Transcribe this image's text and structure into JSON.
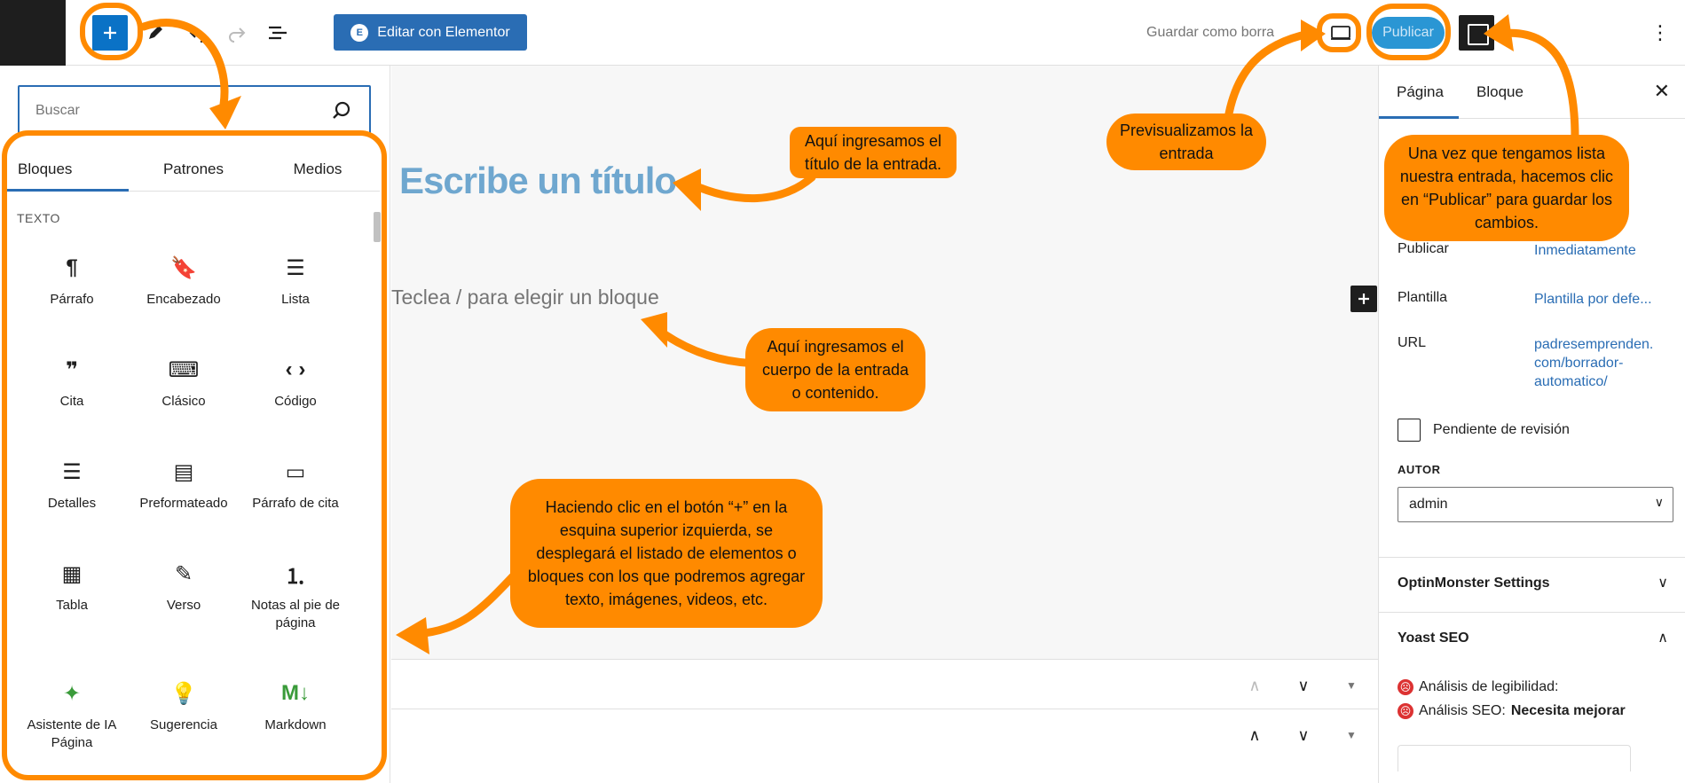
{
  "topbar": {
    "add_block_icon": "plus-icon",
    "elementor_label": "Editar con Elementor",
    "save_draft": "Guardar como borra",
    "publish": "Publicar"
  },
  "inserter": {
    "search_placeholder": "Buscar",
    "tabs": [
      "Bloques",
      "Patrones",
      "Medios"
    ],
    "category": "TEXTO",
    "blocks": [
      {
        "label": "Párrafo",
        "icon": "paragraph-icon",
        "glyph": "¶"
      },
      {
        "label": "Encabezado",
        "icon": "bookmark-icon",
        "glyph": "🔖"
      },
      {
        "label": "Lista",
        "icon": "list-icon",
        "glyph": "☰"
      },
      {
        "label": "Cita",
        "icon": "quote-icon",
        "glyph": "❞"
      },
      {
        "label": "Clásico",
        "icon": "keyboard-icon",
        "glyph": "⌨"
      },
      {
        "label": "Código",
        "icon": "code-icon",
        "glyph": "‹ ›"
      },
      {
        "label": "Detalles",
        "icon": "details-icon",
        "glyph": "☰"
      },
      {
        "label": "Preformateado",
        "icon": "preformatted-icon",
        "glyph": "▤"
      },
      {
        "label": "Párrafo de cita",
        "icon": "pullquote-icon",
        "glyph": "▭"
      },
      {
        "label": "Tabla",
        "icon": "table-icon",
        "glyph": "▦"
      },
      {
        "label": "Verso",
        "icon": "feather-icon",
        "glyph": "✎"
      },
      {
        "label": "Notas al pie de página",
        "icon": "footnotes-icon",
        "glyph": "⒈"
      },
      {
        "label": "Asistente de IA Página",
        "icon": "sparkles-icon",
        "glyph": "✦"
      },
      {
        "label": "Sugerencia",
        "icon": "lightbulb-icon",
        "glyph": "💡"
      },
      {
        "label": "Markdown",
        "icon": "markdown-icon",
        "glyph": "M↓"
      }
    ]
  },
  "editor": {
    "title_placeholder": "Escribe un título",
    "body_placeholder": "Teclea / para elegir un bloque"
  },
  "sidebar": {
    "tabs": [
      "Página",
      "Bloque"
    ],
    "publish_label": "Publicar",
    "publish_value": "Inmediatamente",
    "template_label": "Plantilla",
    "template_value": "Plantilla por defe...",
    "url_label": "URL",
    "url_value_1": "padresemprenden.",
    "url_value_2": "com/borrador-",
    "url_value_3": "automatico/",
    "pending_review": "Pendiente de revisión",
    "author_label": "AUTOR",
    "author_value": "admin",
    "optin_title": "OptinMonster Settings",
    "yoast_title": "Yoast SEO",
    "readability": "Análisis de legibilidad:",
    "seo_analysis": "Análisis SEO:",
    "seo_status": "Necesita mejorar"
  },
  "annotations": {
    "title_note": "Aquí ingresamos el título de la entrada.",
    "body_note": "Aquí ingresamos el cuerpo de la entrada o contenido.",
    "inserter_note": "Haciendo clic en el botón “+” en la esquina superior izquierda, se desplegará el listado de elementos o bloques con los que podremos agregar texto, imágenes, videos, etc.",
    "preview_note": "Previsualizamos la entrada",
    "publish_note": "Una vez que tengamos lista nuestra entrada, hacemos clic en “Publicar” para guardar los cambios.",
    "accent_color": "#ff8a00"
  }
}
